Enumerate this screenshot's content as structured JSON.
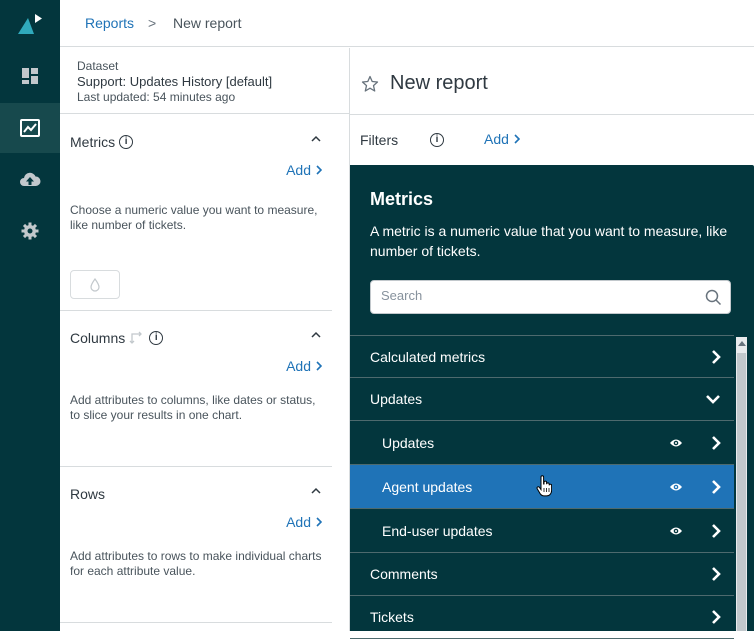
{
  "breadcrumb": {
    "parent": "Reports",
    "separator": ">",
    "current": "New report"
  },
  "dataset": {
    "label": "Dataset",
    "name": "Support: Updates History [default]",
    "last_updated": "Last updated: 54 minutes ago"
  },
  "sections": {
    "metrics": {
      "title": "Metrics",
      "add": "Add",
      "description": "Choose a numeric value you want to measure, like number of tickets."
    },
    "columns": {
      "title": "Columns",
      "add": "Add",
      "description": "Add attributes to columns, like dates or status, to slice your results in one chart."
    },
    "rows": {
      "title": "Rows",
      "add": "Add",
      "description": "Add attributes to rows to make individual charts for each attribute value."
    }
  },
  "report": {
    "title": "New report"
  },
  "filters": {
    "label": "Filters",
    "add": "Add"
  },
  "metrics_popover": {
    "title": "Metrics",
    "description": "A metric is a numeric value that you want to measure, like number of tickets.",
    "search_placeholder": "Search",
    "items": [
      {
        "label": "Calculated metrics"
      },
      {
        "label": "Updates"
      },
      {
        "label": "Updates"
      },
      {
        "label": "Agent updates"
      },
      {
        "label": "End-user updates"
      },
      {
        "label": "Comments"
      },
      {
        "label": "Tickets"
      }
    ]
  },
  "colors": {
    "nav_bg": "#03363d",
    "accent": "#1f73b7",
    "highlight": "#1f73b7",
    "logo": "#30aabc"
  },
  "icons": [
    "logo-icon",
    "dashboard-icon",
    "reporting-icon",
    "upload-icon",
    "settings-icon",
    "info-icon",
    "star-icon",
    "search-icon",
    "eye-icon",
    "chevron-right-icon",
    "chevron-down-icon",
    "chevron-up-icon",
    "swap-icon",
    "drop-icon",
    "hand-cursor-icon"
  ]
}
